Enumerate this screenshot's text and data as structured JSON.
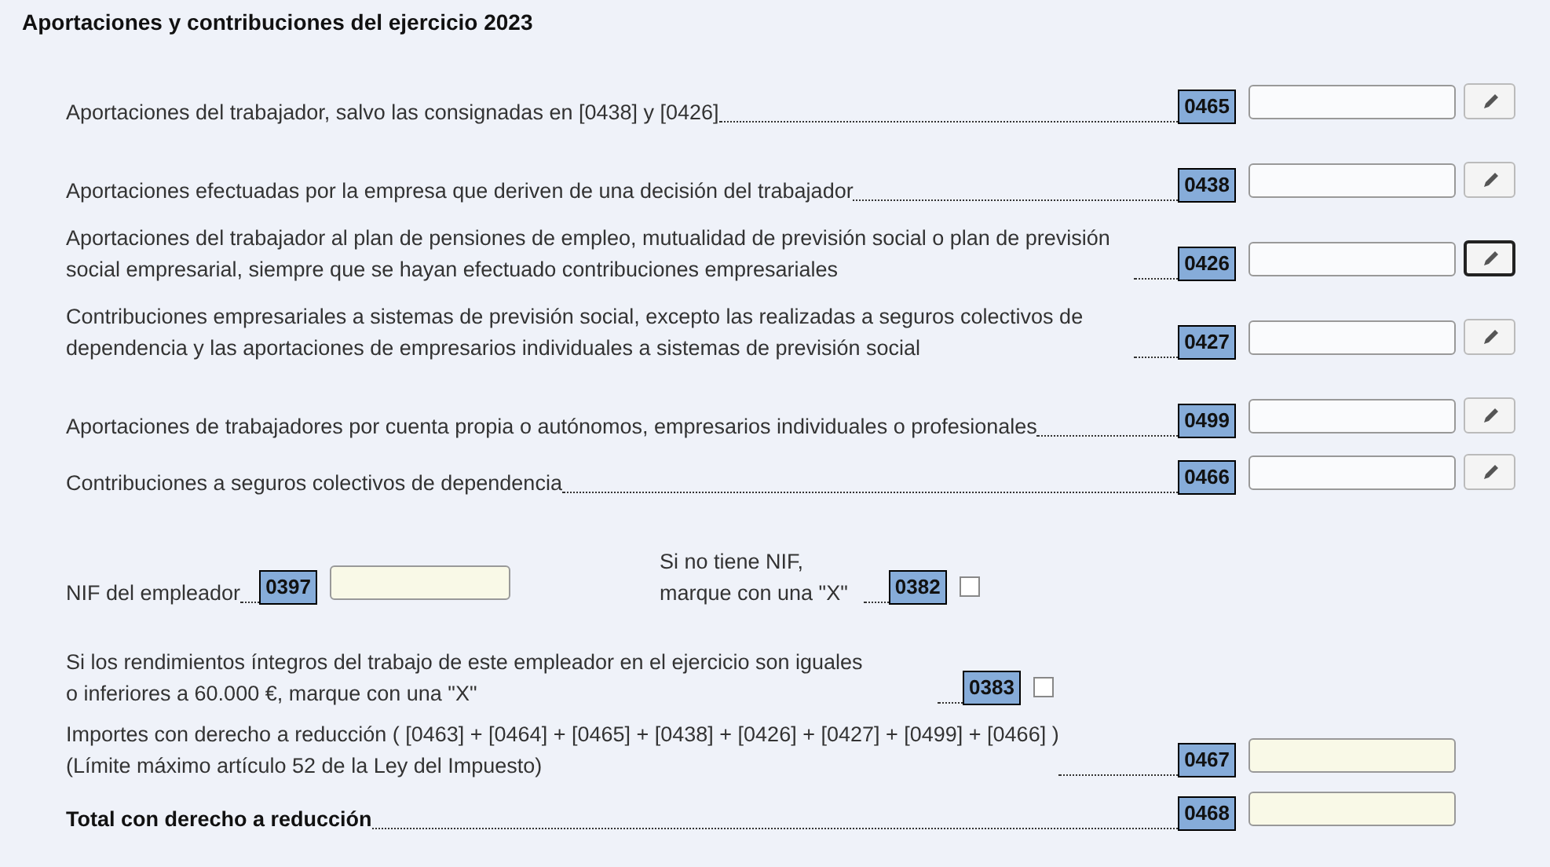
{
  "title": "Aportaciones y contribuciones del ejercicio 2023",
  "rows": [
    {
      "label": "Aportaciones del trabajador, salvo las consignadas en [0438] y [0426]",
      "code": "0465",
      "focused": false
    },
    {
      "label": "Aportaciones efectuadas por la empresa que deriven de una decisión del trabajador",
      "code": "0438",
      "focused": false
    },
    {
      "label": "Aportaciones del trabajador al plan de pensiones de empleo, mutualidad de previsión social o plan de previsión social empresarial, siempre que se hayan efectuado contribuciones empresariales",
      "code": "0426",
      "focused": true
    },
    {
      "label": "Contribuciones empresariales a sistemas de previsión social, excepto las realizadas a seguros colectivos de dependencia y las aportaciones de empresarios individuales a sistemas de previsión social",
      "code": "0427",
      "focused": false
    },
    {
      "label": "Aportaciones de trabajadores por cuenta propia o autónomos, empresarios individuales o profesionales",
      "code": "0499",
      "focused": false
    },
    {
      "label": "Contribuciones a seguros colectivos de dependencia",
      "code": "0466",
      "focused": false
    }
  ],
  "nif": {
    "label": "NIF del empleador",
    "code": "0397",
    "alt_label": "Si no tiene NIF,\nmarque con una \"X\"",
    "alt_code": "0382",
    "alt_checked": false
  },
  "limit": {
    "label": "Si los rendimientos íntegros del trabajo de este empleador en el ejercicio son iguales o inferiores a 60.000 €, marque con una \"X\"",
    "code": "0383",
    "checked": false
  },
  "totals": [
    {
      "label": "Importes con derecho a reducción ( [0463] + [0464] + [0465] + [0438] + [0426] + [0427] + [0499] + [0466] )\n(Límite máximo artículo 52 de la Ley del Impuesto)",
      "code": "0467",
      "bold": false
    },
    {
      "label": "Total con derecho a reducción",
      "code": "0468",
      "bold": true
    }
  ]
}
